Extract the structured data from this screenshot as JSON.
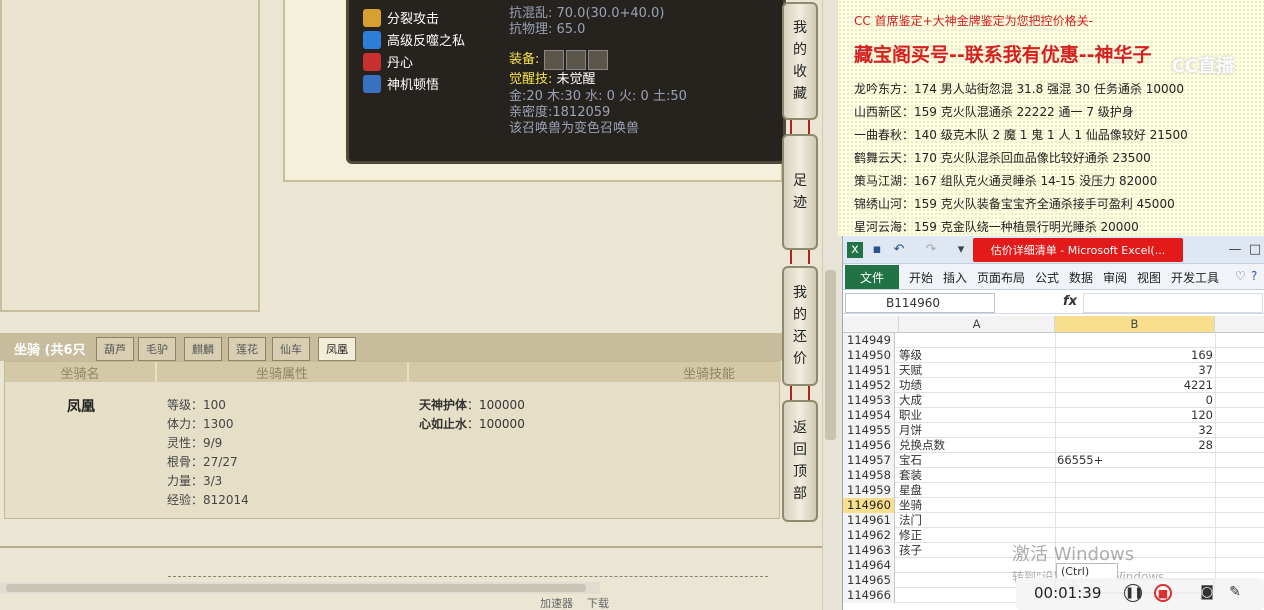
{
  "game": {
    "tooltip": {
      "skills": [
        {
          "name": "分裂攻击",
          "icon": "split-attack-icon",
          "color": "#d8a030"
        },
        {
          "name": "高级反噬之私",
          "icon": "backlash-icon",
          "color": "#2f7fd8"
        },
        {
          "name": "丹心",
          "icon": "danxin-icon",
          "color": "#c73030"
        },
        {
          "name": "神机顿悟",
          "icon": "enlightenment-icon",
          "color": "#3a70c0"
        }
      ],
      "resist_chaos": "抗混乱: 70.0(30.0+40.0)",
      "resist_physical": "抗物理: 65.0",
      "equip_label": "装备:",
      "awaken_label": "觉醒技:",
      "awaken_value": "未觉醒",
      "elements": "金:20 木:30 水: 0 火: 0 土:50",
      "intimacy": "亲密度:1812059",
      "note": "该召唤兽为变色召唤兽"
    },
    "side_buttons": [
      {
        "id": "favorites",
        "chars": [
          "我",
          "的",
          "收",
          "藏"
        ]
      },
      {
        "id": "footprint",
        "chars": [
          "足",
          "迹"
        ]
      },
      {
        "id": "my-bargain",
        "chars": [
          "我",
          "的",
          "还",
          "价"
        ]
      },
      {
        "id": "back-top",
        "chars": [
          "返",
          "回",
          "顶",
          "部"
        ]
      }
    ],
    "mount": {
      "section_title": "坐骑 (共6只",
      "tabs": [
        "葫芦",
        "毛驴",
        "麒麟",
        "莲花",
        "仙车",
        "凤凰"
      ],
      "active_tab": 5,
      "col_name": "坐骑名",
      "col_attr": "坐骑属性",
      "col_skill": "坐骑技能",
      "name": "凤凰",
      "attrs": [
        "等级：100",
        "体力：1300",
        "灵性：9/9",
        "根骨：27/27",
        "力量：3/3",
        "经验：812014"
      ],
      "skills": [
        {
          "label": "天神护体",
          "value": "：100000"
        },
        {
          "label": "心如止水",
          "value": "：100000"
        }
      ]
    },
    "bottom_toolbar": [
      "加速器",
      "下载"
    ]
  },
  "ad": {
    "line_top": "CC 首席鉴定+大神金牌鉴定为您把控价格关-",
    "title": "藏宝阁买号--联系我有优惠--神华子",
    "logo": "CC直播",
    "entries": [
      "龙吟东方：174 男人站街忽混 31.8 强混 30 任务通杀 10000",
      "山西新区：159 克火队混通杀 22222 通一 7 级护身",
      "一曲春秋：140 级克木队 2 魔 1 鬼 1 人 1 仙品像较好 21500",
      "鹤舞云天：170 克火队混杀回血品像比较好通杀 23500",
      "策马江湖：167 组队克火通灵睡杀 14-15 没压力 82000",
      "锦绣山河：159 克火队装备宝宝齐全通杀接手可盈利 45000",
      "星河云海：159 克金队绕一种植景行明光睡杀 20000"
    ]
  },
  "excel": {
    "title": "估价详细清单 - Microsoft Excel(...",
    "ribbon_tabs": [
      "开始",
      "插入",
      "页面布局",
      "公式",
      "数据",
      "审阅",
      "视图",
      "开发工具"
    ],
    "file_tab": "文件",
    "name_box": "B114960",
    "fx": "fx",
    "col_headers": [
      "A",
      "B"
    ],
    "rows": [
      {
        "n": "114949",
        "a": "",
        "b": ""
      },
      {
        "n": "114950",
        "a": "等级",
        "b": "169"
      },
      {
        "n": "114951",
        "a": "天赋",
        "b": "37"
      },
      {
        "n": "114952",
        "a": "功绩",
        "b": "4221"
      },
      {
        "n": "114953",
        "a": "大成",
        "b": "0"
      },
      {
        "n": "114954",
        "a": "职业",
        "b": "120"
      },
      {
        "n": "114955",
        "a": "月饼",
        "b": "32"
      },
      {
        "n": "114956",
        "a": "兑换点数",
        "b": "28"
      },
      {
        "n": "114957",
        "a": "宝石",
        "b": "66555+",
        "left": true
      },
      {
        "n": "114958",
        "a": "套装",
        "b": ""
      },
      {
        "n": "114959",
        "a": "星盘",
        "b": ""
      },
      {
        "n": "114960",
        "a": "坐骑",
        "b": ""
      },
      {
        "n": "114961",
        "a": "法门",
        "b": ""
      },
      {
        "n": "114962",
        "a": "修正",
        "b": ""
      },
      {
        "n": "114963",
        "a": "孩子",
        "b": ""
      },
      {
        "n": "114964",
        "a": "",
        "b": ""
      },
      {
        "n": "114965",
        "a": "",
        "b": ""
      },
      {
        "n": "114966",
        "a": "",
        "b": ""
      }
    ],
    "selected_row": "114960",
    "paste_options": "(Ctrl)"
  },
  "overlay": {
    "activate": "激活 Windows",
    "activate_sub": "转到\"设置\"以激活 Windows。",
    "timer": "00:01:39"
  }
}
